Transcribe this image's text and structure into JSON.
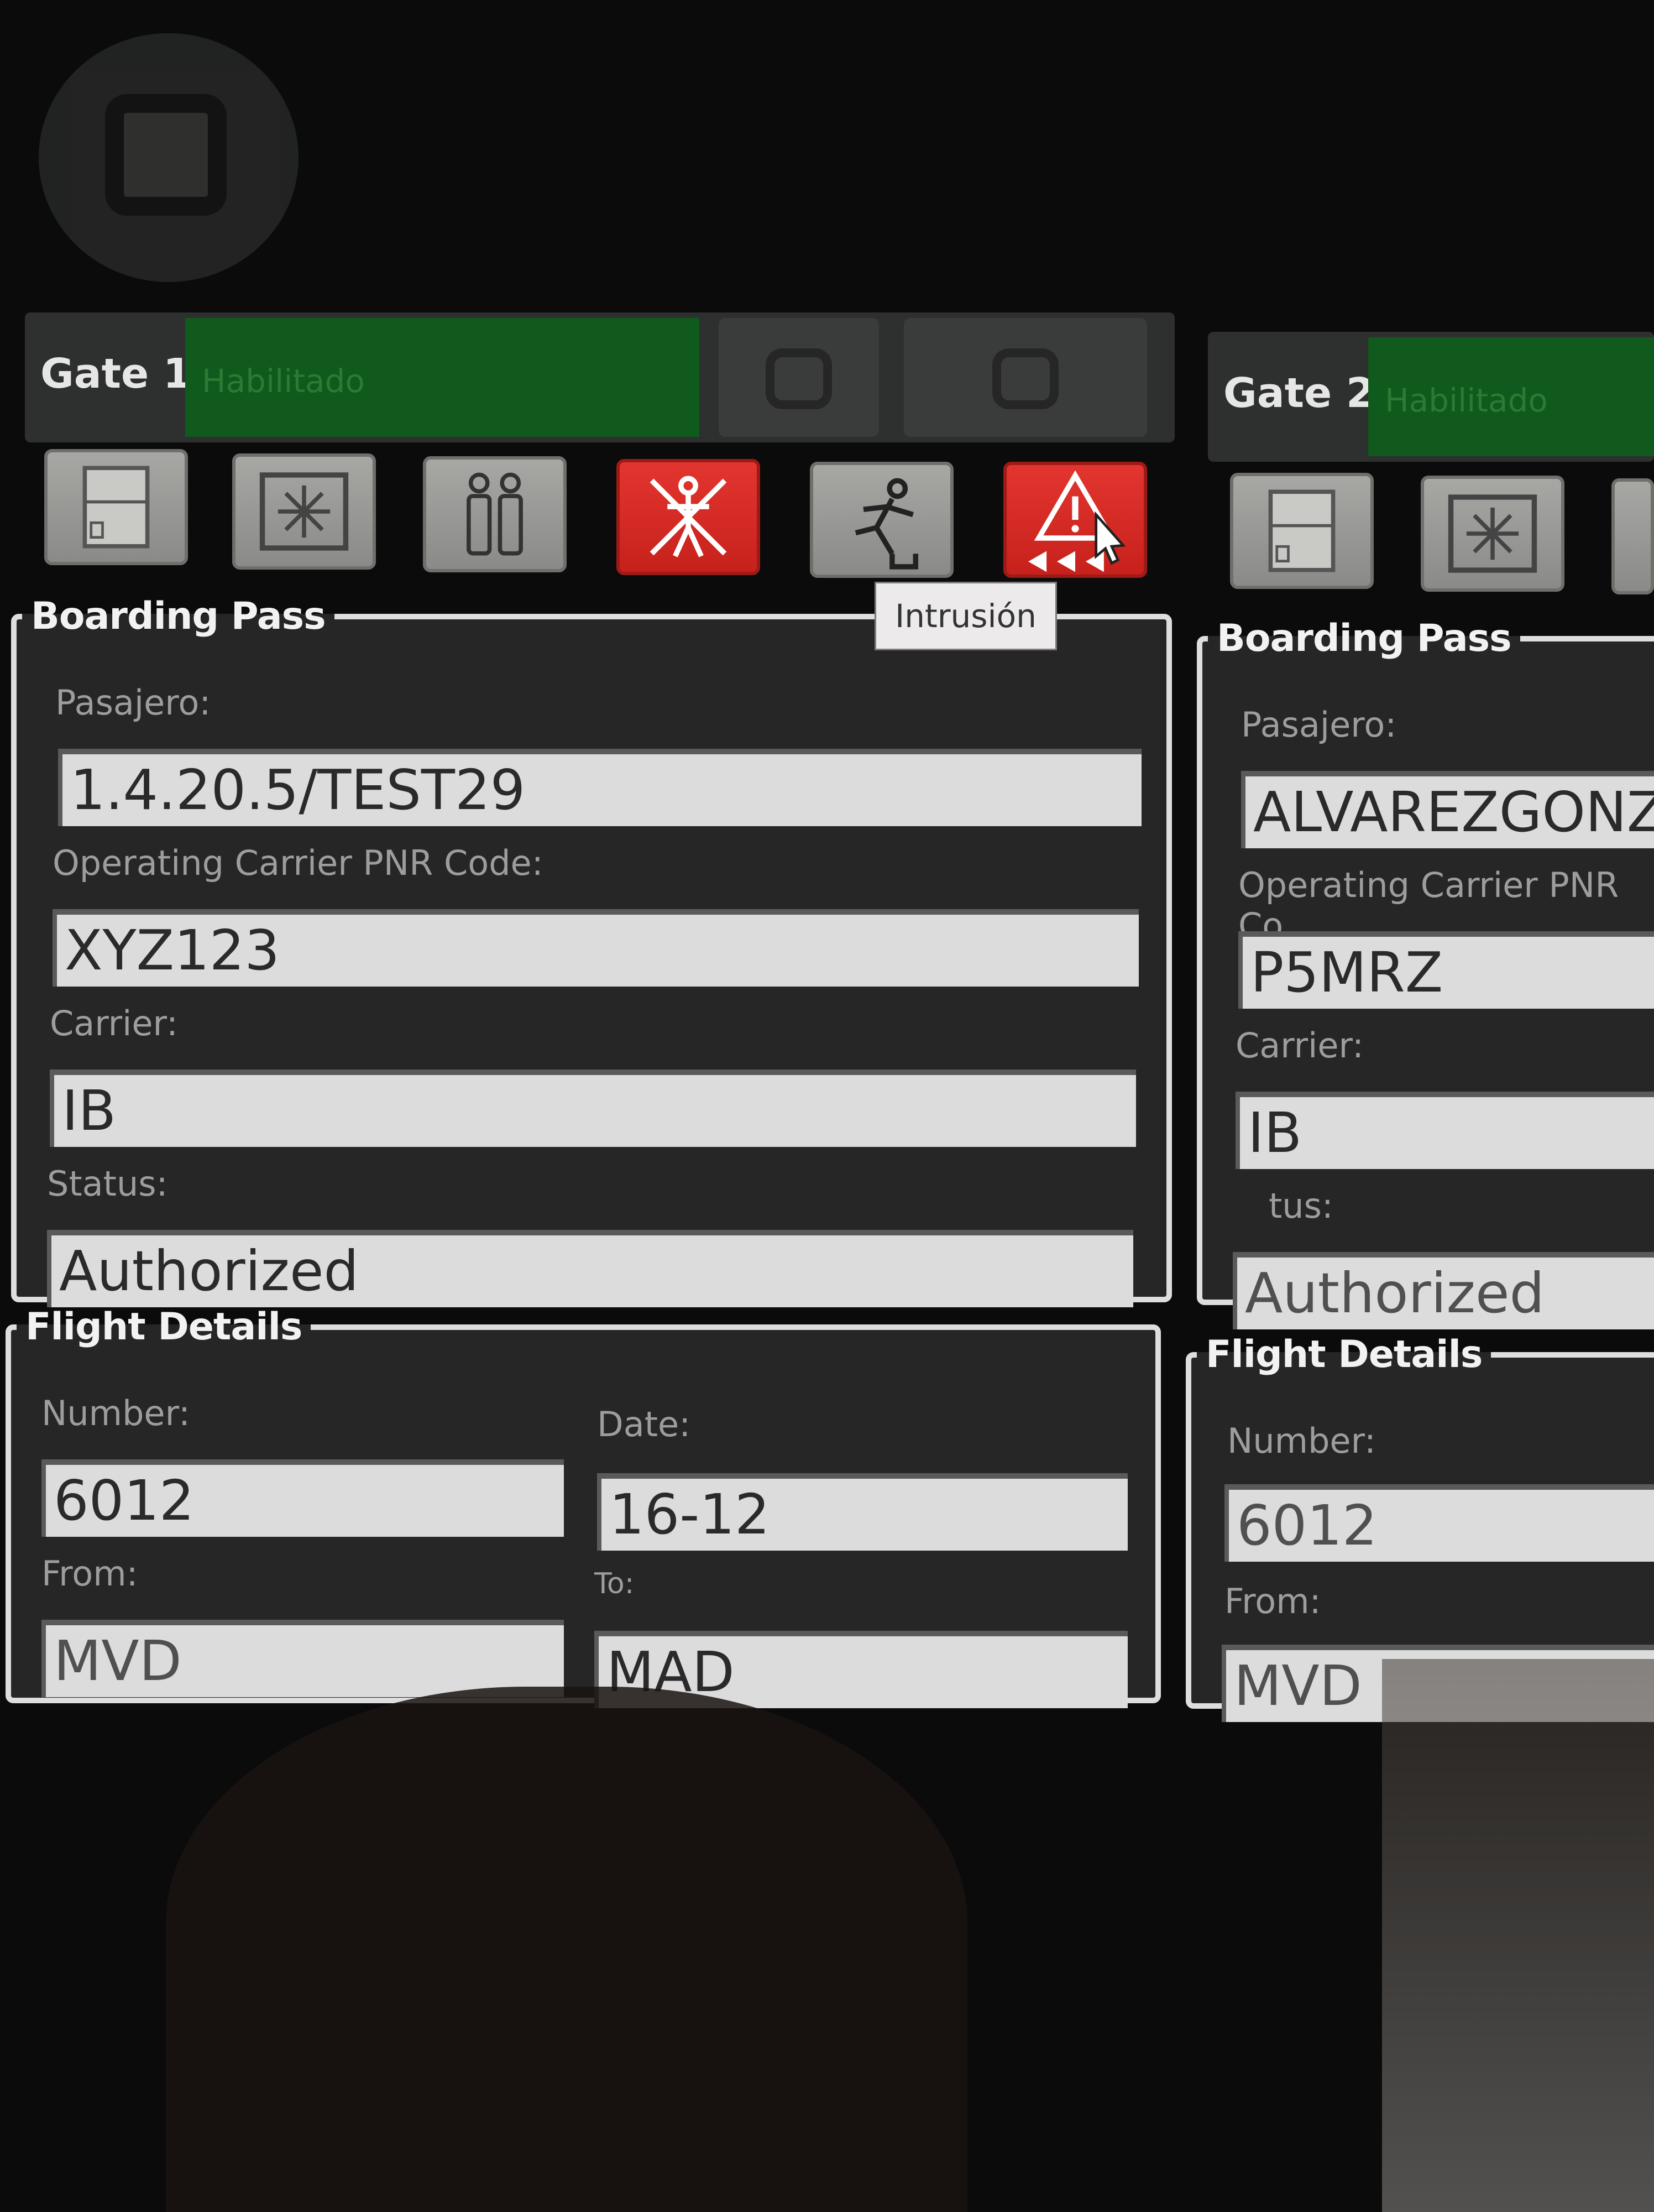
{
  "gate1": {
    "label": "Gate 1",
    "status": "Habilitado",
    "tooltip": "Intrusión",
    "icons": [
      "door-icon",
      "scanner-icon",
      "people-icon",
      "no-person-alarm-icon",
      "running-person-icon",
      "warning-alarm-icon"
    ],
    "boarding_pass": {
      "title": "Boarding Pass",
      "passenger_label": "Pasajero:",
      "passenger_value": "1.4.20.5/TEST29",
      "pnr_label": "Operating Carrier PNR Code:",
      "pnr_value": "XYZ123",
      "carrier_label": "Carrier:",
      "carrier_value": "IB",
      "status_label": "Status:",
      "status_value": "Authorized"
    },
    "flight_details": {
      "title": "Flight Details",
      "number_label": "Number:",
      "number_value": "6012",
      "date_label": "Date:",
      "date_value": "16-12",
      "from_label": "From:",
      "from_value": "MVD",
      "to_label": "To:",
      "to_value": "MAD"
    }
  },
  "gate2": {
    "label": "Gate 2",
    "status": "Habilitado",
    "boarding_pass": {
      "title": "Boarding Pass",
      "passenger_label": "Pasajero:",
      "passenger_value": "ALVAREZGONZA",
      "pnr_label": "Operating Carrier PNR Co",
      "pnr_value": "P5MRZ",
      "carrier_label": "Carrier:",
      "carrier_value": "IB",
      "status_label": "tus:",
      "status_value": "Authorized"
    },
    "flight_details": {
      "title": "Flight Details",
      "number_label": "Number:",
      "number_value": "6012",
      "from_label": "From:",
      "from_value": "MVD"
    }
  },
  "colors": {
    "status_bar": "#0f5a1c",
    "alarm_red": "#d42a24",
    "field_bg": "#dcdcdc",
    "panel_bg": "#262626"
  }
}
